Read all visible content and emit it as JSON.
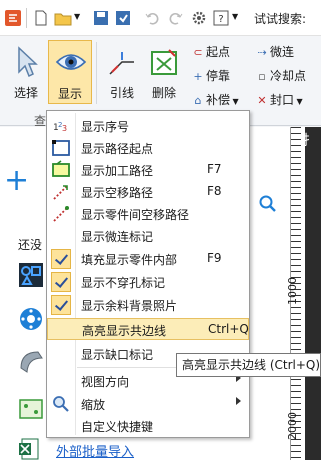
{
  "quick_access": {
    "search_label": "试试搜索:",
    "icons": [
      "app-logo-icon",
      "new-file-icon",
      "open-folder-icon",
      "save-icon",
      "save-as-icon",
      "undo-icon",
      "redo-icon",
      "settings-icon",
      "help-icon"
    ]
  },
  "ribbon": {
    "buttons": {
      "select": "选择",
      "display": "显示",
      "lead": "引线",
      "delete": "删除"
    },
    "small_buttons": {
      "start_point": "起点",
      "micro_connect": "微连",
      "stop": "停靠",
      "cooling_point": "冷却点",
      "compensate": "补偿",
      "seal": "封口"
    },
    "group_label": "查"
  },
  "left_panel": {
    "still_text": "还没",
    "bottom_link": "外部批量导入"
  },
  "ruler": {
    "numbers": [
      "1000",
      "2000"
    ],
    "top_char": "扌"
  },
  "menu": {
    "items": [
      {
        "label": "显示序号",
        "shortcut": "",
        "icon": "sequence-number-icon",
        "checked": false,
        "submenu": false
      },
      {
        "label": "显示路径起点",
        "shortcut": "",
        "icon": "path-start-icon",
        "checked": false,
        "submenu": false
      },
      {
        "label": "显示加工路径",
        "shortcut": "F7",
        "icon": "machining-path-icon",
        "checked": false,
        "submenu": false
      },
      {
        "label": "显示空移路径",
        "shortcut": "F8",
        "icon": "idle-path-icon",
        "checked": false,
        "submenu": false
      },
      {
        "label": "显示零件间空移路径",
        "shortcut": "",
        "icon": "part-idle-path-icon",
        "checked": false,
        "submenu": false
      },
      {
        "label": "显示微连标记",
        "shortcut": "",
        "icon": "",
        "checked": false,
        "submenu": false
      },
      {
        "label": "填充显示零件内部",
        "shortcut": "F9",
        "icon": "",
        "checked": true,
        "submenu": false
      },
      {
        "label": "显示不穿孔标记",
        "shortcut": "",
        "icon": "",
        "checked": true,
        "submenu": false
      },
      {
        "label": "显示余料背景照片",
        "shortcut": "",
        "icon": "",
        "checked": true,
        "submenu": false
      },
      {
        "label": "高亮显示共边线",
        "shortcut": "Ctrl+Q",
        "icon": "",
        "checked": false,
        "submenu": false,
        "highlighted": true
      },
      {
        "label": "显示缺口标记",
        "shortcut": "",
        "icon": "",
        "checked": false,
        "submenu": false
      },
      {
        "label": "视图方向",
        "shortcut": "",
        "icon": "",
        "checked": false,
        "submenu": true
      },
      {
        "label": "缩放",
        "shortcut": "",
        "icon": "zoom-icon",
        "checked": false,
        "submenu": true
      },
      {
        "label": "自定义快捷键",
        "shortcut": "",
        "icon": "",
        "checked": false,
        "submenu": false
      }
    ]
  },
  "tooltip": {
    "text": "高亮显示共边线 (Ctrl+Q)"
  },
  "colors": {
    "highlight_bg": "#fcedb8",
    "check_bg": "#fde39a",
    "active_button_bg": "#fde7a8",
    "link": "#1a5fc8",
    "accent_blue": "#1e7fd6"
  }
}
